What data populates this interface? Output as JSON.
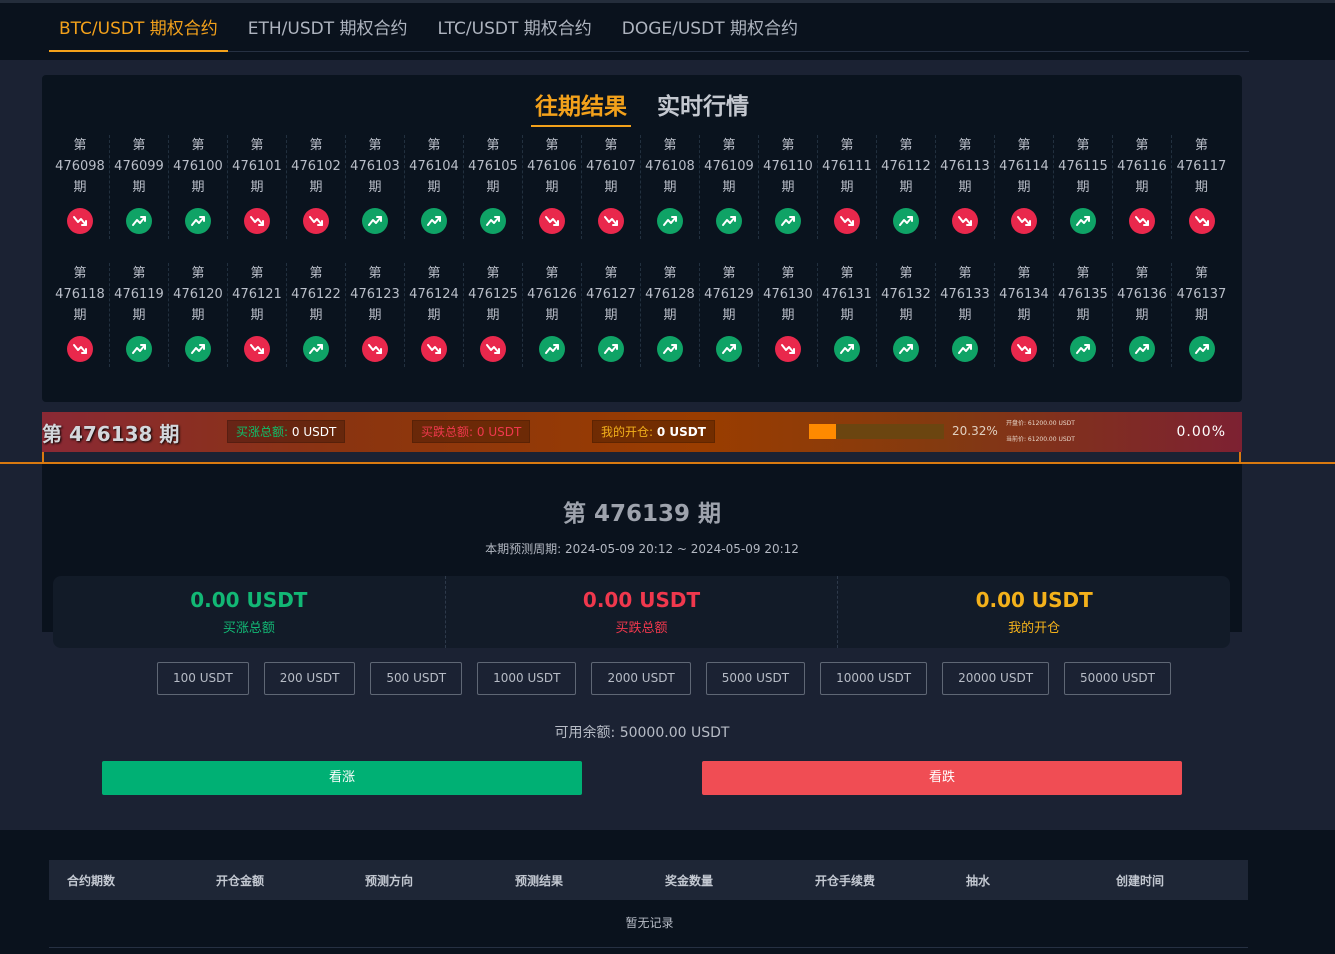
{
  "tabs": [
    {
      "label": "BTC/USDT 期权合约",
      "active": true
    },
    {
      "label": "ETH/USDT 期权合约",
      "active": false
    },
    {
      "label": "LTC/USDT 期权合约",
      "active": false
    },
    {
      "label": "DOGE/USDT 期权合约",
      "active": false
    }
  ],
  "history": {
    "tabs": [
      "往期结果",
      "实时行情"
    ],
    "prefix": "第",
    "suffix": "期",
    "rows": [
      [
        {
          "id": "476098",
          "dir": "down"
        },
        {
          "id": "476099",
          "dir": "up"
        },
        {
          "id": "476100",
          "dir": "up"
        },
        {
          "id": "476101",
          "dir": "down"
        },
        {
          "id": "476102",
          "dir": "down"
        },
        {
          "id": "476103",
          "dir": "up"
        },
        {
          "id": "476104",
          "dir": "up"
        },
        {
          "id": "476105",
          "dir": "up"
        },
        {
          "id": "476106",
          "dir": "down"
        },
        {
          "id": "476107",
          "dir": "down"
        },
        {
          "id": "476108",
          "dir": "up"
        },
        {
          "id": "476109",
          "dir": "up"
        },
        {
          "id": "476110",
          "dir": "up"
        },
        {
          "id": "476111",
          "dir": "down"
        },
        {
          "id": "476112",
          "dir": "up"
        },
        {
          "id": "476113",
          "dir": "down"
        },
        {
          "id": "476114",
          "dir": "down"
        },
        {
          "id": "476115",
          "dir": "up"
        },
        {
          "id": "476116",
          "dir": "down"
        },
        {
          "id": "476117",
          "dir": "down"
        }
      ],
      [
        {
          "id": "476118",
          "dir": "down"
        },
        {
          "id": "476119",
          "dir": "up"
        },
        {
          "id": "476120",
          "dir": "up"
        },
        {
          "id": "476121",
          "dir": "down"
        },
        {
          "id": "476122",
          "dir": "up"
        },
        {
          "id": "476123",
          "dir": "down"
        },
        {
          "id": "476124",
          "dir": "down"
        },
        {
          "id": "476125",
          "dir": "down"
        },
        {
          "id": "476126",
          "dir": "up"
        },
        {
          "id": "476127",
          "dir": "up"
        },
        {
          "id": "476128",
          "dir": "up"
        },
        {
          "id": "476129",
          "dir": "up"
        },
        {
          "id": "476130",
          "dir": "down"
        },
        {
          "id": "476131",
          "dir": "up"
        },
        {
          "id": "476132",
          "dir": "up"
        },
        {
          "id": "476133",
          "dir": "up"
        },
        {
          "id": "476134",
          "dir": "down"
        },
        {
          "id": "476135",
          "dir": "up"
        },
        {
          "id": "476136",
          "dir": "up"
        },
        {
          "id": "476137",
          "dir": "up"
        }
      ]
    ]
  },
  "banner": {
    "title": "第 476138 期",
    "buy_up_label": "买涨总额:",
    "buy_up_value": "0 USDT",
    "buy_down_label": "买跌总额:",
    "buy_down_value": "0 USDT",
    "my_open_label": "我的开仓:",
    "my_open_value": "0 USDT",
    "progress": 0.2032,
    "progress_text": "20.32%",
    "open_price": "开盘价: 61200.00 USDT",
    "current_price": "当前价: 61200.00 USDT",
    "change": "0.00%"
  },
  "current": {
    "title": "第 476139 期",
    "period": "本期预测周期: 2024-05-09 20:12 ~ 2024-05-09 20:12",
    "totals": [
      {
        "value": "0.00 USDT",
        "label": "买涨总额",
        "color": "#12b875"
      },
      {
        "value": "0.00 USDT",
        "label": "买跌总额",
        "color": "#f0384d"
      },
      {
        "value": "0.00 USDT",
        "label": "我的开仓",
        "color": "#f3b11b"
      }
    ]
  },
  "amounts": [
    "100 USDT",
    "200 USDT",
    "500 USDT",
    "1000 USDT",
    "2000 USDT",
    "5000 USDT",
    "10000 USDT",
    "20000 USDT",
    "50000 USDT"
  ],
  "balance": "可用余额: 50000.00 USDT",
  "buttons": {
    "up": "看涨",
    "down": "看跌"
  },
  "table": {
    "headers": [
      "合约期数",
      "开仓金额",
      "预测方向",
      "预测结果",
      "奖金数量",
      "开仓手续费",
      "抽水",
      "创建时间"
    ],
    "empty": "暂无记录"
  },
  "colors": {
    "accent": "#f3a11b",
    "up": "#0fa366",
    "down": "#e9284c"
  }
}
